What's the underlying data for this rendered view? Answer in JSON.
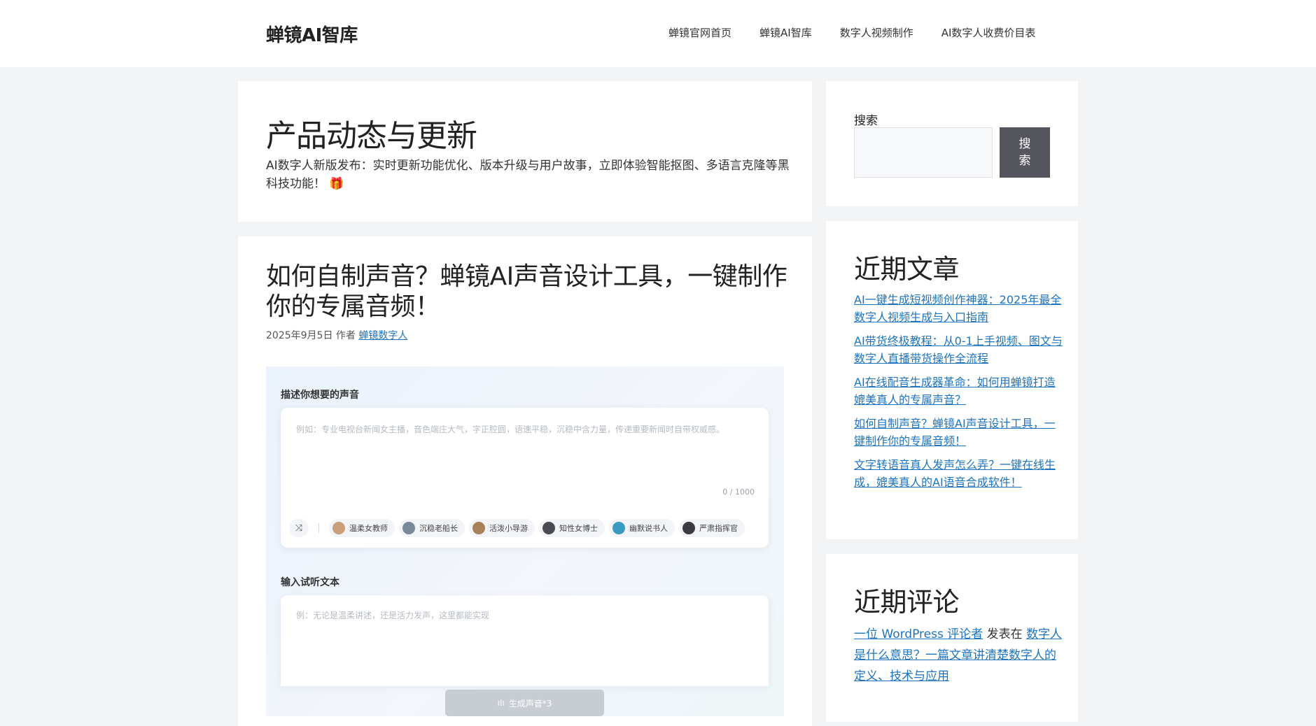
{
  "site": {
    "title": "蝉镜AI智库"
  },
  "nav": [
    {
      "label": "蝉镜官网首页"
    },
    {
      "label": "蝉镜AI智库"
    },
    {
      "label": "数字人视频制作"
    },
    {
      "label": "AI数字人收费价目表"
    }
  ],
  "archive": {
    "title": "产品动态与更新",
    "description": "AI数字人新版发布：实时更新功能优化、版本升级与用户故事，立即体验智能抠图、多语言克隆等黑科技功能！",
    "emoji": "🎁"
  },
  "post": {
    "title": "如何自制声音？蝉镜AI声音设计工具，一键制作你的专属音频！",
    "date": "2025年9月5日",
    "by": "作者",
    "author": "蝉镜数字人",
    "screenshot": {
      "describe_label": "描述你想要的声音",
      "describe_placeholder": "例如：专业电视台新闻女主播，音色端庄大气，字正腔圆，语速平稳，沉稳中含力量，传递重要新闻时自带权威感。",
      "counter": "0 / 1000",
      "voices": [
        {
          "name": "温柔女教师",
          "color": "#c9a07a"
        },
        {
          "name": "沉稳老船长",
          "color": "#7a8a9a"
        },
        {
          "name": "活泼小导游",
          "color": "#a8805a"
        },
        {
          "name": "知性女博士",
          "color": "#4a4a55"
        },
        {
          "name": "幽默说书人",
          "color": "#3a9ac0"
        },
        {
          "name": "严肃指挥官",
          "color": "#3a3a40"
        }
      ],
      "text_label": "输入试听文本",
      "text_placeholder": "例：无论是温柔讲述，还是活力发声，这里都能实现",
      "generate_label": "生成声音*3"
    }
  },
  "sidebar": {
    "search_label": "搜索",
    "search_button": "搜索",
    "recent_title": "近期文章",
    "recent_posts": [
      "AI一键生成短视频创作神器：2025年最全数字人视频生成与入口指南",
      "AI带货终极教程：从0-1上手视频、图文与数字人直播带货操作全流程",
      "AI在线配音生成器革命：如何用蝉镜打造媲美真人的专属声音？",
      "如何自制声音？蝉镜AI声音设计工具，一键制作你的专属音频！",
      "文字转语音真人发声怎么弄？一键在线生成，媲美真人的AI语音合成软件！"
    ],
    "comments_title": "近期评论",
    "comment": {
      "author": "一位 WordPress 评论者",
      "on": "发表在",
      "post": "数字人是什么意思？一篇文章讲清楚数字人的定义、技术与应用"
    }
  }
}
